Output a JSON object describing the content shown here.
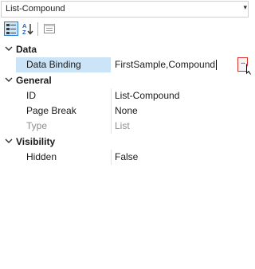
{
  "object_selector": {
    "value": "List-Compound"
  },
  "toolbar": {
    "categorized": {
      "icon": "categorized-icon",
      "active": true
    },
    "alphabetical": {
      "icon": "sort-alphabetical-icon"
    },
    "property_pages": {
      "icon": "property-pages-icon"
    }
  },
  "properties": {
    "data": {
      "label": "Data",
      "data_binding": {
        "name": "Data Binding",
        "value": "FirstSample,Compound",
        "ellipsis": "..."
      }
    },
    "general": {
      "label": "General",
      "id": {
        "name": "ID",
        "value": "List-Compound"
      },
      "page_break": {
        "name": "Page Break",
        "value": "None"
      },
      "type": {
        "name": "Type",
        "value": "List"
      }
    },
    "visibility": {
      "label": "Visibility",
      "hidden": {
        "name": "Hidden",
        "value": "False"
      }
    }
  }
}
